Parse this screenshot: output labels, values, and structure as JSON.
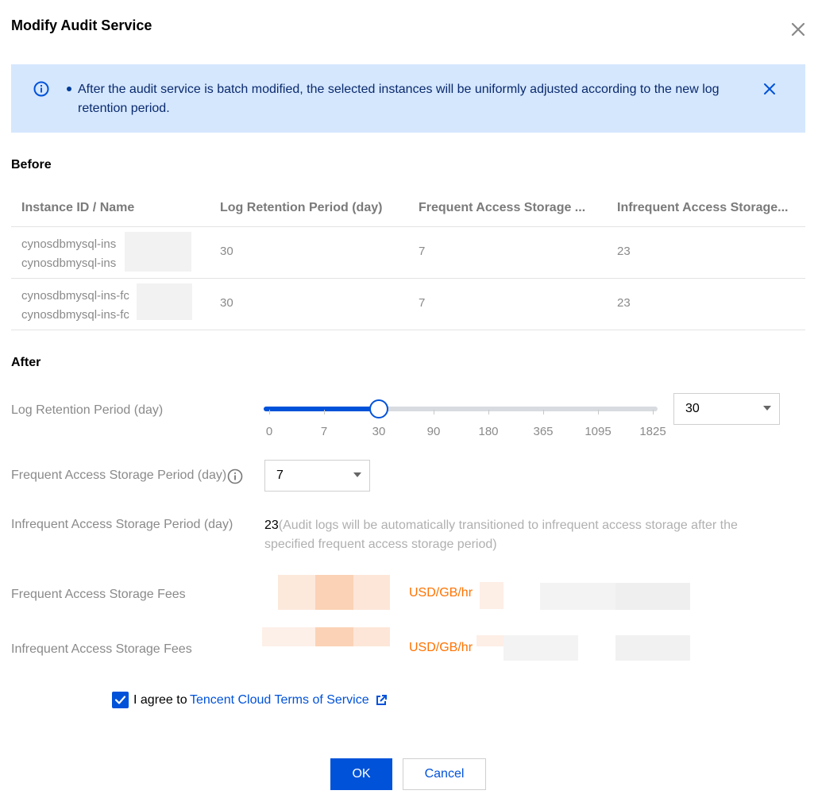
{
  "dialog": {
    "title": "Modify Audit Service"
  },
  "notice": {
    "message": "After the audit service is batch modified, the selected instances will be uniformly adjusted according to the new log retention period."
  },
  "before": {
    "heading": "Before",
    "columns": [
      "Instance ID / Name",
      "Log Retention Period (day)",
      "Frequent Access Storage ...",
      "Infrequent Access Storage..."
    ],
    "rows": [
      {
        "id": "cynosdbmysql-ins",
        "name": "cynosdbmysql-ins",
        "retention": "30",
        "frequent": "7",
        "infrequent": "23"
      },
      {
        "id": "cynosdbmysql-ins-fc",
        "name": "cynosdbmysql-ins-fc",
        "retention": "30",
        "frequent": "7",
        "infrequent": "23"
      }
    ]
  },
  "after": {
    "heading": "After",
    "retention_label": "Log Retention Period (day)",
    "slider": {
      "ticks": [
        "0",
        "7",
        "30",
        "90",
        "180",
        "365",
        "1095",
        "1825"
      ],
      "selected_index": 2
    },
    "retention_value": "30",
    "frequent_label": "Frequent Access Storage Period (day)",
    "frequent_value": "7",
    "infrequent_label": "Infrequent Access Storage Period (day)",
    "infrequent_value": "23",
    "infrequent_note": "(Audit logs will be automatically transitioned to infrequent access storage after the specified frequent access storage period)",
    "frequent_fee_label": "Frequent Access Storage Fees",
    "infrequent_fee_label": "Infrequent Access Storage Fees",
    "fee_unit": "USD/GB/hr"
  },
  "agreement": {
    "prefix": "I agree to",
    "link": "Tencent Cloud Terms of Service",
    "checked": true
  },
  "buttons": {
    "ok": "OK",
    "cancel": "Cancel"
  },
  "colors": {
    "primary": "#0052d9",
    "notice_bg": "#d5e7fd",
    "price": "#ff7200"
  }
}
